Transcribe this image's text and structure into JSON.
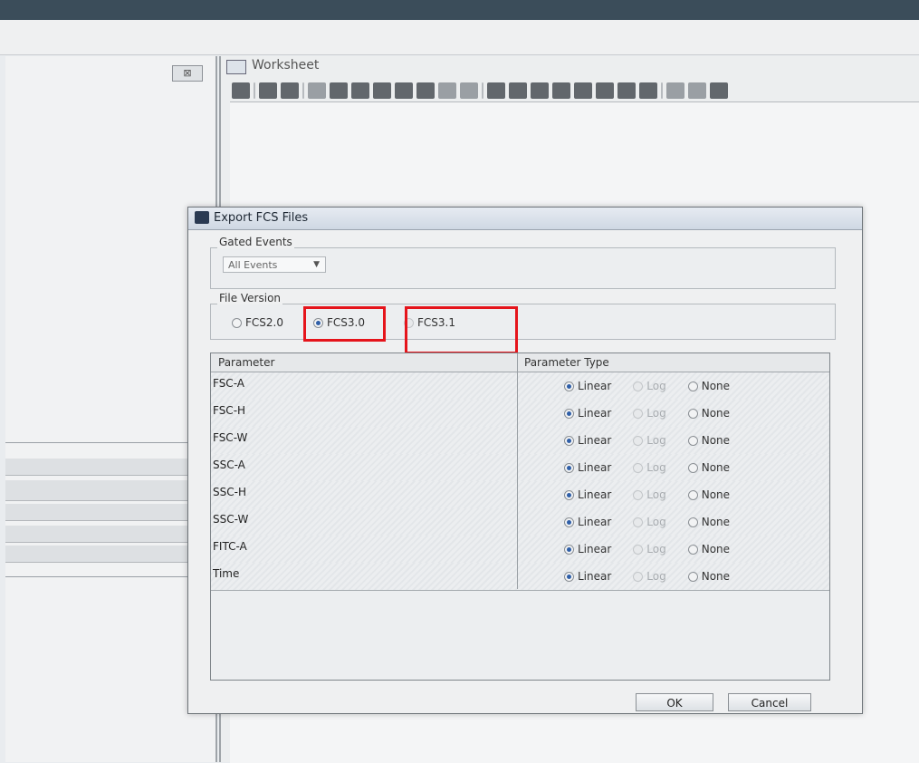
{
  "worksheet": {
    "title": "Worksheet",
    "left_panel_close": "⊠"
  },
  "dialog": {
    "title": "Export FCS Files",
    "gated_events": {
      "label": "Gated Events",
      "selected": "All Events"
    },
    "file_version": {
      "label": "File Version",
      "options": [
        "FCS2.0",
        "FCS3.0",
        "FCS3.1"
      ],
      "selected": "FCS3.0"
    },
    "table": {
      "col_parameter": "Parameter",
      "col_type": "Parameter Type",
      "type_options": [
        "Linear",
        "Log",
        "None"
      ],
      "rows": [
        {
          "name": "FSC-A",
          "type": "Linear"
        },
        {
          "name": "FSC-H",
          "type": "Linear"
        },
        {
          "name": "FSC-W",
          "type": "Linear"
        },
        {
          "name": "SSC-A",
          "type": "Linear"
        },
        {
          "name": "SSC-H",
          "type": "Linear"
        },
        {
          "name": "SSC-W",
          "type": "Linear"
        },
        {
          "name": "FITC-A",
          "type": "Linear"
        },
        {
          "name": "Time",
          "type": "Linear"
        }
      ]
    },
    "buttons": {
      "ok": "OK",
      "cancel": "Cancel"
    }
  },
  "colors": {
    "highlight": "#e5141b",
    "radio_selected": "#2f5fa8"
  }
}
